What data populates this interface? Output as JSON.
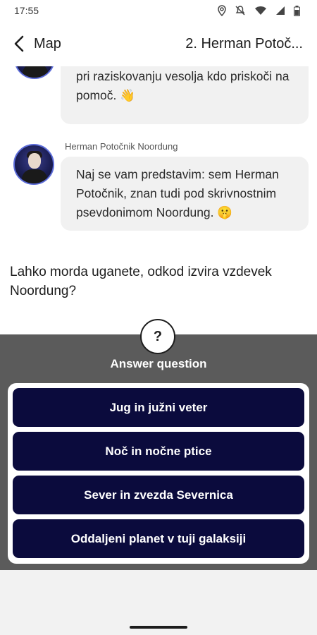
{
  "status_bar": {
    "time": "17:55",
    "icons": [
      "location-icon",
      "mute-icon",
      "wifi-icon",
      "signal-icon",
      "battery-icon"
    ]
  },
  "header": {
    "back_label": "Map",
    "title": "2. Herman Potoč..."
  },
  "chat": {
    "messages": [
      {
        "sender": "",
        "text": "Pozdravljeni! Vedno sem vesel, ko mi pri raziskovanju vesolja kdo priskoči na pomoč. 👋"
      },
      {
        "sender": "Herman Potočnik Noordung",
        "text": "Naj se vam predstavim: sem Herman Potočnik, znan tudi pod skrivnostnim psevdonimom Noordung. 🤫"
      }
    ],
    "question": "Lahko morda uganete, odkod izvira vzdevek Noordung?"
  },
  "answer_panel": {
    "badge": "?",
    "title": "Answer question",
    "options": [
      "Jug in južni veter",
      "Noč in nočne ptice",
      "Sever in zvezda Severnica",
      "Oddaljeni planet v tuji galaksiji"
    ]
  },
  "colors": {
    "answer_button_bg": "#0b0b3d",
    "panel_bg": "#5b5b5b",
    "bubble_bg": "#f1f1f1"
  }
}
